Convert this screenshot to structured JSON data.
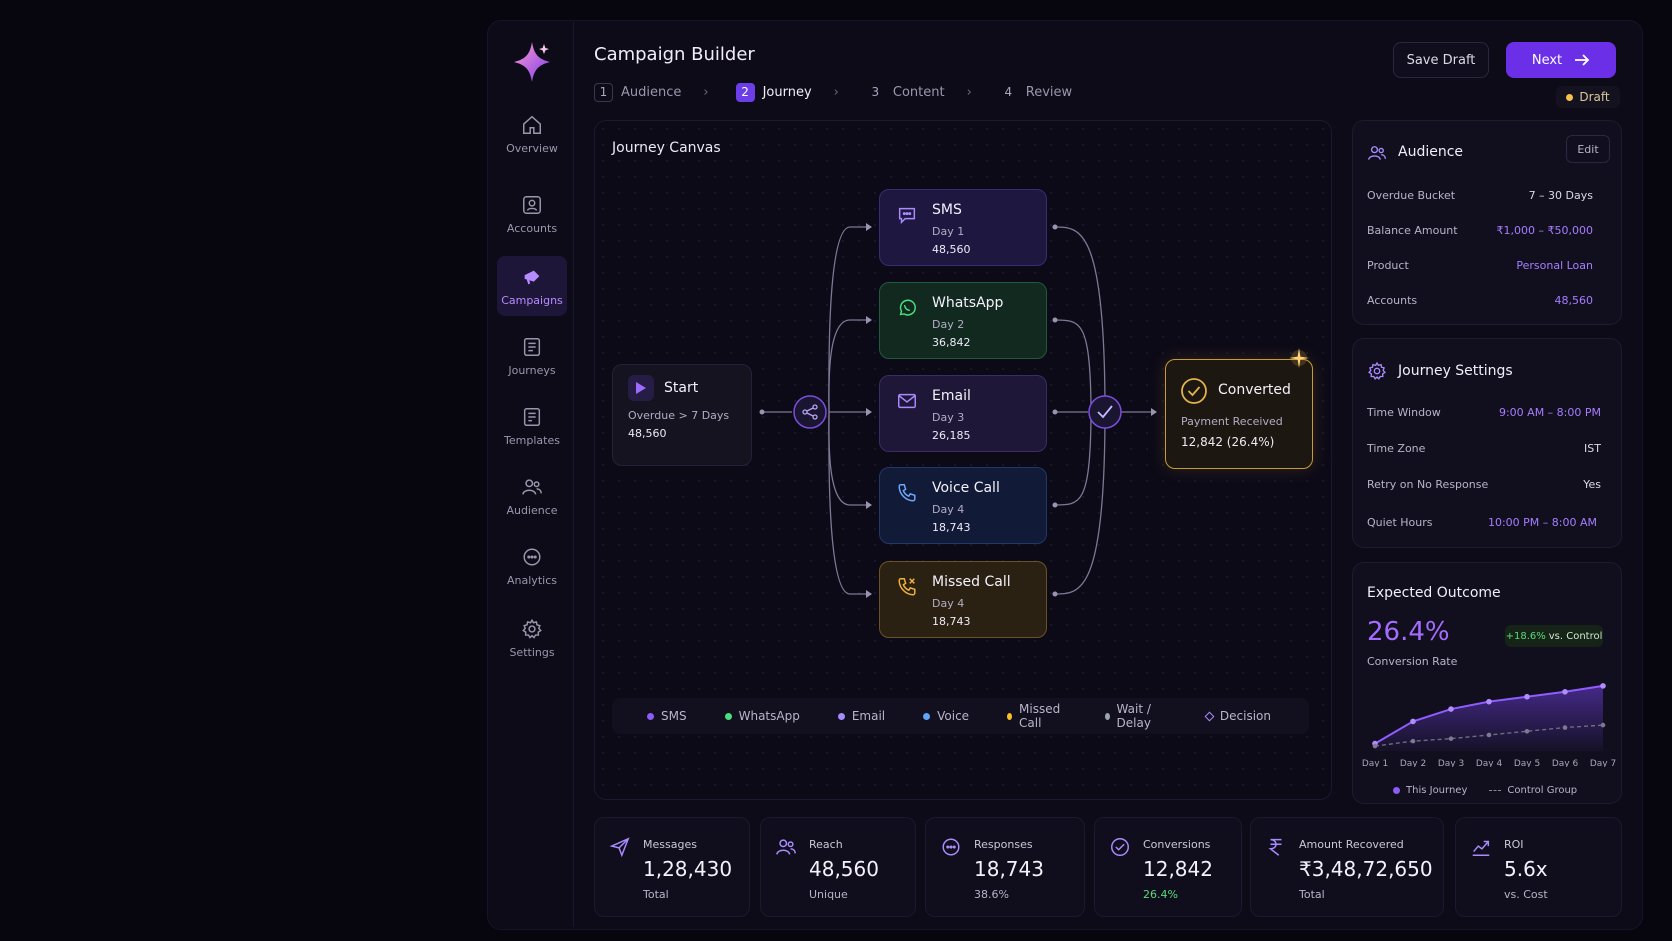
{
  "app": {
    "title": "Campaign Builder"
  },
  "sidebar": {
    "items": [
      {
        "label": "Overview",
        "icon": "home-icon"
      },
      {
        "label": "Accounts",
        "icon": "user-card-icon"
      },
      {
        "label": "Campaigns",
        "icon": "megaphone-icon",
        "active": true
      },
      {
        "label": "Journeys",
        "icon": "document-icon"
      },
      {
        "label": "Templates",
        "icon": "template-icon"
      },
      {
        "label": "Audience",
        "icon": "users-icon"
      },
      {
        "label": "Analytics",
        "icon": "chat-icon"
      },
      {
        "label": "Settings",
        "icon": "gear-icon"
      }
    ]
  },
  "steps": [
    {
      "num": "1",
      "label": "Audience"
    },
    {
      "num": "2",
      "label": "Journey",
      "active": true
    },
    {
      "num": "3",
      "label": "Content"
    },
    {
      "num": "4",
      "label": "Review"
    }
  ],
  "header": {
    "save_label": "Save Draft",
    "next_label": "Next",
    "status": "Draft"
  },
  "canvas": {
    "title": "Journey Canvas",
    "start": {
      "title": "Start",
      "sub": "Overdue > 7 Days",
      "value": "48,560"
    },
    "channels": [
      {
        "key": "sms",
        "title": "SMS",
        "day": "Day 1",
        "value": "48,560"
      },
      {
        "key": "wa",
        "title": "WhatsApp",
        "day": "Day 2",
        "value": "36,842"
      },
      {
        "key": "email",
        "title": "Email",
        "day": "Day 3",
        "value": "26,185"
      },
      {
        "key": "voice",
        "title": "Voice Call",
        "day": "Day 4",
        "value": "18,743"
      },
      {
        "key": "missed",
        "title": "Missed Call",
        "day": "Day 4",
        "value": "18,743"
      }
    ],
    "converted": {
      "title": "Converted",
      "sub": "Payment Received",
      "value": "12,842 (26.4%)"
    },
    "legend": [
      {
        "label": "SMS",
        "color": "#8b5cf6"
      },
      {
        "label": "WhatsApp",
        "color": "#4ade80"
      },
      {
        "label": "Email",
        "color": "#a78bfa"
      },
      {
        "label": "Voice",
        "color": "#60a5fa"
      },
      {
        "label": "Missed Call",
        "color": "#fbbf24"
      },
      {
        "label": "Wait / Delay",
        "color": "#9ca3af"
      },
      {
        "label": "Decision",
        "color": "#a78bfa"
      }
    ]
  },
  "audience": {
    "title": "Audience",
    "edit_label": "Edit",
    "rows": [
      {
        "label": "Overdue Bucket",
        "value": "7 – 30 Days"
      },
      {
        "label": "Balance Amount",
        "value": "₹1,000 – ₹50,000"
      },
      {
        "label": "Product",
        "value": "Personal Loan"
      },
      {
        "label": "Accounts",
        "value": "48,560"
      }
    ]
  },
  "settings": {
    "title": "Journey Settings",
    "rows": [
      {
        "label": "Time Window",
        "value": "9:00 AM – 8:00 PM"
      },
      {
        "label": "Time Zone",
        "value": "IST"
      },
      {
        "label": "Retry on No Response",
        "value": "Yes"
      },
      {
        "label": "Quiet Hours",
        "value": "10:00 PM – 8:00 AM"
      }
    ]
  },
  "outcome": {
    "title": "Expected Outcome",
    "rate": "26.4%",
    "rate_label": "Conversion Rate",
    "delta": "+18.6%",
    "delta_suffix": "vs. Control"
  },
  "chart_data": {
    "type": "area",
    "categories": [
      "Day 1",
      "Day 2",
      "Day 3",
      "Day 4",
      "Day 5",
      "Day 6",
      "Day 7"
    ],
    "series": [
      {
        "name": "This Journey",
        "color": "#8b5cf6",
        "values": [
          3,
          12,
          17,
          20,
          22,
          24,
          26.4
        ]
      },
      {
        "name": "Control Group",
        "color": "#6b7280",
        "values": [
          2,
          4,
          5,
          6.5,
          8,
          9.5,
          10.5
        ]
      }
    ],
    "ylim": [
      0,
      30
    ],
    "grid": false,
    "legend": "bottom"
  },
  "kpis": [
    {
      "label": "Messages",
      "value": "1,28,430",
      "sub": "Total",
      "icon": "send-icon"
    },
    {
      "label": "Reach",
      "value": "48,560",
      "sub": "Unique",
      "icon": "users-icon"
    },
    {
      "label": "Responses",
      "value": "18,743",
      "sub": "38.6%",
      "icon": "chat-icon"
    },
    {
      "label": "Conversions",
      "value": "12,842",
      "sub": "26.4%",
      "icon": "check-circle-icon",
      "sub_green": true
    },
    {
      "label": "Amount Recovered",
      "value": "₹3,48,72,650",
      "sub": "Total",
      "icon": "rupee-icon"
    },
    {
      "label": "ROI",
      "value": "5.6x",
      "sub": "vs. Cost",
      "icon": "trend-up-icon"
    }
  ]
}
